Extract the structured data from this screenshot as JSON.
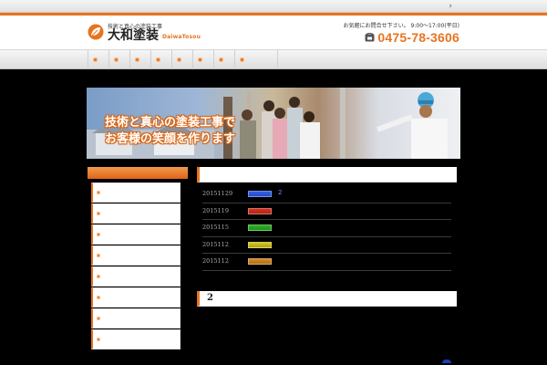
{
  "topbar": {
    "chevron": "›"
  },
  "header": {
    "logo": {
      "tagline": "技術と真心の塗装工事",
      "name": "大和塗装",
      "roman": "DaiwaTosou"
    },
    "contact": {
      "note": "お気軽にお問合せ下さい。 9:00〜17:00(平日)",
      "phone": "0475-78-3606",
      "phone_icon": "phone-icon"
    }
  },
  "nav": {
    "items": [
      "",
      "",
      "",
      "",
      "",
      "",
      "",
      ""
    ]
  },
  "hero": {
    "line1": "技術と真心の塗装工事で",
    "line2": "お客様の笑顔を作ります"
  },
  "sidebar": {
    "items": [
      "",
      "",
      "",
      "",
      "",
      "",
      "",
      ""
    ]
  },
  "news": {
    "heading": "",
    "items": [
      {
        "date": "20151129",
        "tag_color": "#2f5ff0",
        "link": "2"
      },
      {
        "date": "2015119",
        "tag_color": "#d8311e",
        "link": ""
      },
      {
        "date": "2015115",
        "tag_color": "#29b420",
        "link": ""
      },
      {
        "date": "2015112",
        "tag_color": "#d8c81e",
        "link": ""
      },
      {
        "date": "2015112",
        "tag_color": "#d98a22",
        "link": ""
      }
    ]
  },
  "section2": {
    "heading": "2"
  },
  "colors": {
    "accent": "#e8731f",
    "link": "#6b8cff"
  }
}
